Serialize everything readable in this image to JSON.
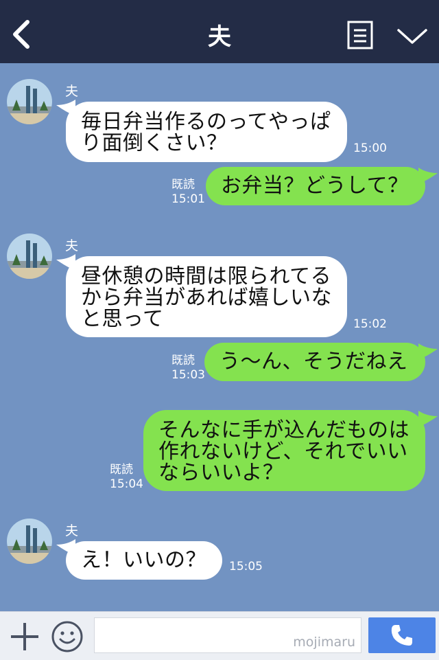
{
  "header": {
    "title": "夫"
  },
  "messages": [
    {
      "sender": "夫",
      "lines": [
        "毎日弁当作るのってやっぱ",
        "り面倒くさい？"
      ],
      "time": "15:00"
    },
    {
      "read": "既読",
      "time": "15:01",
      "lines": [
        "お弁当？どうして？"
      ]
    },
    {
      "sender": "夫",
      "lines": [
        "昼休憩の時間は限られてる",
        "から弁当があれば嬉しいな",
        "と思って"
      ],
      "time": "15:02"
    },
    {
      "read": "既読",
      "time": "15:03",
      "lines": [
        "う～ん、そうだねえ"
      ]
    },
    {
      "read": "既読",
      "time": "15:04",
      "lines": [
        "そんなに手が込んだものは",
        "作れないけど、それでいい",
        "ならいいよ？"
      ]
    },
    {
      "sender": "夫",
      "lines": [
        "え！いいの？"
      ],
      "time": "15:05"
    }
  ],
  "footer": {
    "watermark": "mojimaru"
  },
  "icons": {
    "back": "chevron-left-icon",
    "notes": "note-icon",
    "menu": "chevron-down-icon",
    "add": "plus-icon",
    "emoji": "smile-icon",
    "call": "phone-icon",
    "avatar": "tower-photo-avatar"
  },
  "colors": {
    "header": "#232c46",
    "background": "#7293c2",
    "incoming_bubble": "#ffffff",
    "outgoing_bubble": "#84e24f",
    "call_button": "#4d84e6"
  }
}
